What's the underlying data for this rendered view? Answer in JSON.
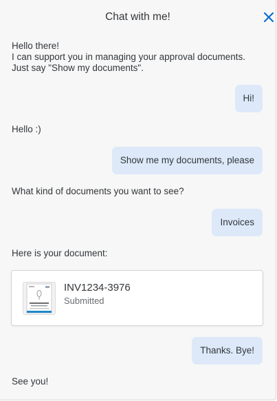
{
  "header": {
    "title": "Chat with me!",
    "close_icon": "close-icon"
  },
  "colors": {
    "accent": "#0a6ed1",
    "user_bubble": "#dde9f9",
    "background": "#f7f7f7"
  },
  "messages": [
    {
      "from": "bot",
      "lines": [
        "Hello there!",
        "I can support you in managing your approval documents.",
        "Just say \"Show my documents\"."
      ]
    },
    {
      "from": "user",
      "text": "Hi!"
    },
    {
      "from": "bot",
      "text": "Hello :)"
    },
    {
      "from": "user",
      "text": "Show me my documents, please"
    },
    {
      "from": "bot",
      "text": "What kind of documents you want to see?"
    },
    {
      "from": "user",
      "text": "Invoices"
    },
    {
      "from": "bot",
      "text": "Here is your document:"
    },
    {
      "from": "user",
      "text": "Thanks. Bye!"
    },
    {
      "from": "bot",
      "text": "See you!"
    }
  ],
  "document_card": {
    "id": "INV1234-3976",
    "status": "Submitted",
    "thumbnail_icon": "invoice-thumbnail-icon"
  }
}
